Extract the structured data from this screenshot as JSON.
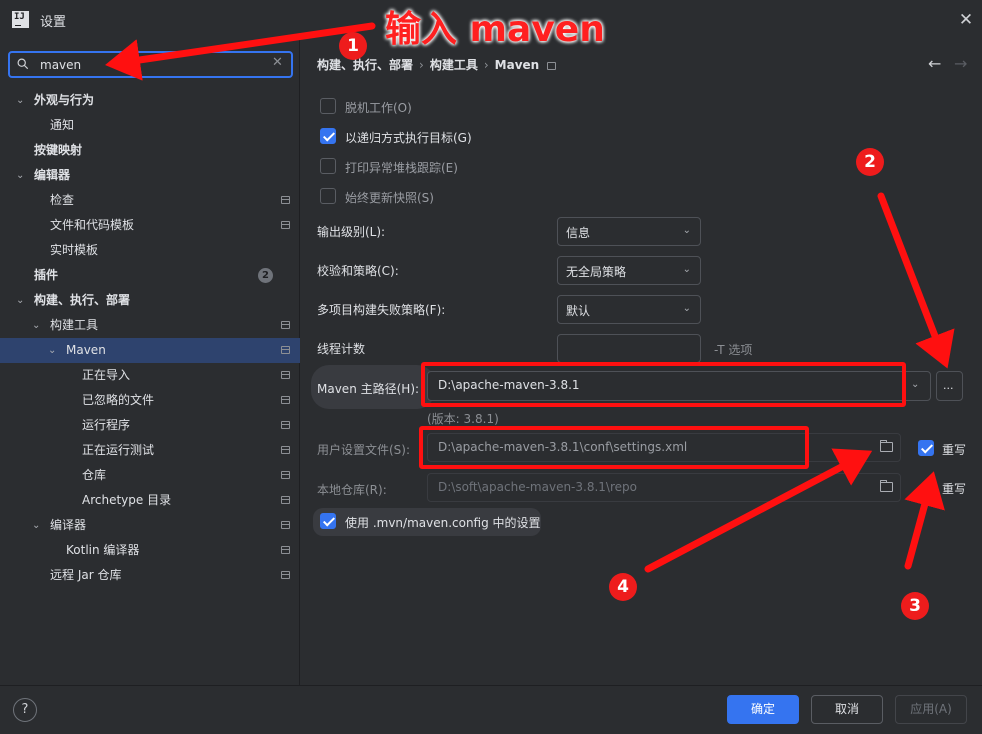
{
  "window": {
    "title": "设置",
    "logo_text": "IJ"
  },
  "search": {
    "value": "maven"
  },
  "sidebar": {
    "items": [
      {
        "label": "外观与行为",
        "bold": true,
        "expanded": true
      },
      {
        "label": "通知"
      },
      {
        "label": "按键映射",
        "bold": true
      },
      {
        "label": "编辑器",
        "bold": true,
        "expanded": true
      },
      {
        "label": "检查",
        "project_scoped": true
      },
      {
        "label": "文件和代码模板",
        "project_scoped": true
      },
      {
        "label": "实时模板"
      },
      {
        "label": "插件",
        "bold": true,
        "badge": "2"
      },
      {
        "label": "构建、执行、部署",
        "bold": true,
        "expanded": true
      },
      {
        "label": "构建工具",
        "expanded": true,
        "project_scoped": true
      },
      {
        "label": "Maven",
        "expanded": true,
        "selected": true,
        "project_scoped": true
      },
      {
        "label": "正在导入",
        "project_scoped": true
      },
      {
        "label": "已忽略的文件",
        "project_scoped": true
      },
      {
        "label": "运行程序",
        "project_scoped": true
      },
      {
        "label": "正在运行测试",
        "project_scoped": true
      },
      {
        "label": "仓库",
        "project_scoped": true
      },
      {
        "label": "Archetype 目录",
        "project_scoped": true
      },
      {
        "label": "编译器",
        "expanded": true,
        "project_scoped": true
      },
      {
        "label": "Kotlin 编译器",
        "project_scoped": true
      },
      {
        "label": "远程 Jar 仓库",
        "project_scoped": true
      }
    ]
  },
  "breadcrumb": {
    "parts": [
      "构建、执行、部署",
      "构建工具",
      "Maven"
    ]
  },
  "options": {
    "offline": {
      "label": "脱机工作(O)",
      "checked": false
    },
    "recursive": {
      "label": "以递归方式执行目标(G)",
      "checked": true
    },
    "stacktrace": {
      "label": "打印异常堆栈跟踪(E)",
      "checked": false
    },
    "update_snapshots": {
      "label": "始终更新快照(S)",
      "checked": false
    }
  },
  "fields": {
    "output_level": {
      "label": "输出级别(L):",
      "value": "信息"
    },
    "checksum": {
      "label": "校验和策略(C):",
      "value": "无全局策略"
    },
    "fail_policy": {
      "label": "多项目构建失败策略(F):",
      "value": "默认"
    },
    "thread_count": {
      "label": "线程计数",
      "value": "",
      "suffix": "-T 选项"
    },
    "maven_home": {
      "label": "Maven 主路径(H):",
      "value": "D:\\apache-maven-3.8.1",
      "browse": "...",
      "version": "(版本: 3.8.1)"
    },
    "user_settings": {
      "label": "用户设置文件(S):",
      "value": "D:\\apache-maven-3.8.1\\conf\\settings.xml",
      "override_label": "重写",
      "override_checked": true
    },
    "local_repo": {
      "label": "本地仓库(R):",
      "value": "D:\\soft\\apache-maven-3.8.1\\repo",
      "override_label": "重写",
      "override_checked": false
    },
    "use_mvn_config": {
      "label": "使用 .mvn/maven.config 中的设置",
      "checked": true
    }
  },
  "footer": {
    "help": "?",
    "ok": "确定",
    "cancel": "取消",
    "apply": "应用(A)"
  },
  "annotations": {
    "headline": "输入 maven",
    "markers": [
      "1",
      "2",
      "3",
      "4"
    ],
    "color": "#ff1010"
  },
  "colors": {
    "accent": "#3574f0",
    "background": "#2b2d30",
    "selection": "#2e436e"
  }
}
